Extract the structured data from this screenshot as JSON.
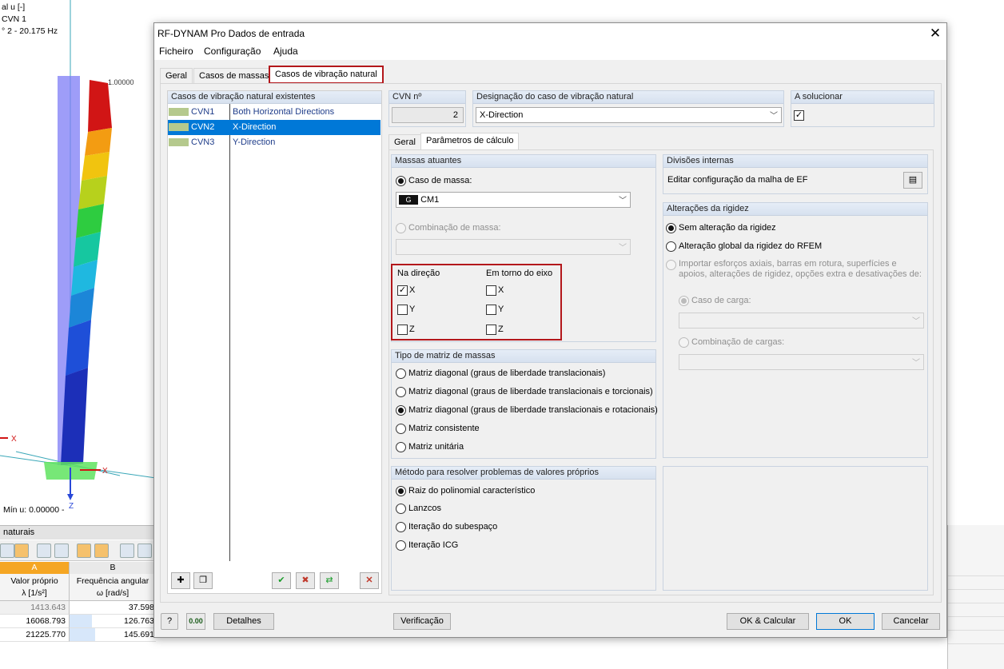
{
  "background": {
    "info_lines": [
      "al u [-]",
      "CVN 1",
      "° 2 - 20.175 Hz"
    ],
    "axis_top_value": "1.00000",
    "axis_x": "X",
    "axis_z": "Z",
    "min_label": "Mín u: 0.00000 -",
    "panel_title": "naturais",
    "table": {
      "col_a": "A",
      "col_b": "B",
      "header_a_line1": "Valor próprio",
      "header_a_line2": "λ [1/s²]",
      "header_b_line1": "Frequência angular",
      "header_b_line2": "ω [rad/s]",
      "rows": [
        {
          "a": "1413.643",
          "b": "37.598"
        },
        {
          "a": "16068.793",
          "b": "126.763"
        },
        {
          "a": "21225.770",
          "b": "145.691"
        }
      ]
    }
  },
  "dialog": {
    "title": "RF-DYNAM Pro Dados de entrada",
    "menu": [
      "Ficheiro",
      "Configuração",
      "Ajuda"
    ],
    "tabs": [
      "Geral",
      "Casos de massas",
      "Casos de vibração natural"
    ],
    "left_panel": {
      "title": "Casos de vibração natural existentes",
      "items": [
        {
          "code": "CVN1",
          "desc": "Both Horizontal Directions",
          "selected": false
        },
        {
          "code": "CVN2",
          "desc": "X-Direction",
          "selected": true
        },
        {
          "code": "CVN3",
          "desc": "Y-Direction",
          "selected": false
        }
      ]
    },
    "cvn": {
      "label": "CVN nº",
      "value": "2"
    },
    "designation": {
      "label": "Designação do caso de vibração natural",
      "value": "X-Direction"
    },
    "solve": {
      "label": "A solucionar",
      "checked": true
    },
    "subtabs": [
      "Geral",
      "Parâmetros de cálculo"
    ],
    "massas": {
      "title": "Massas atuantes",
      "caso_label": "Caso de massa:",
      "caso_badge": "G",
      "caso_value": "CM1",
      "combinacao_label": "Combinação de massa:",
      "na_direcao": "Na direção",
      "em_torno": "Em torno do eixo",
      "axes": [
        "X",
        "Y",
        "Z"
      ],
      "direction_checked": [
        true,
        false,
        false
      ],
      "rotation_checked": [
        false,
        false,
        false
      ]
    },
    "matriz": {
      "title": "Tipo de matriz de massas",
      "options": [
        "Matriz diagonal (graus de liberdade translacionais)",
        "Matriz diagonal (graus de liberdade translacionais e torcionais)",
        "Matriz diagonal (graus de liberdade translacionais e rotacionais)",
        "Matriz consistente",
        "Matriz unitária"
      ],
      "selected": 2
    },
    "metodo": {
      "title": "Método para resolver problemas de valores próprios",
      "options": [
        "Raiz do polinomial característico",
        "Lanzcos",
        "Iteração do subespaço",
        "Iteração ICG"
      ],
      "selected": 0
    },
    "divisoes": {
      "title": "Divisões internas",
      "text": "Editar configuração da malha de EF"
    },
    "rigidez": {
      "title": "Alterações da rigidez",
      "opt1": "Sem alteração da rigidez",
      "opt2": "Alteração global da rigidez do RFEM",
      "opt3_line1": "Importar esforços axiais, barras em rotura, superfícies e",
      "opt3_line2": "apoios, alterações de rigidez, opções extra e desativações de:",
      "caso_carga": "Caso de carga:",
      "combinacao_cargas": "Combinação de cargas:"
    },
    "buttons": {
      "detalhes": "Detalhes",
      "verificacao": "Verificação",
      "ok_calcular": "OK & Calcular",
      "ok": "OK",
      "cancelar": "Cancelar",
      "units_icon_label": "0.00"
    }
  }
}
